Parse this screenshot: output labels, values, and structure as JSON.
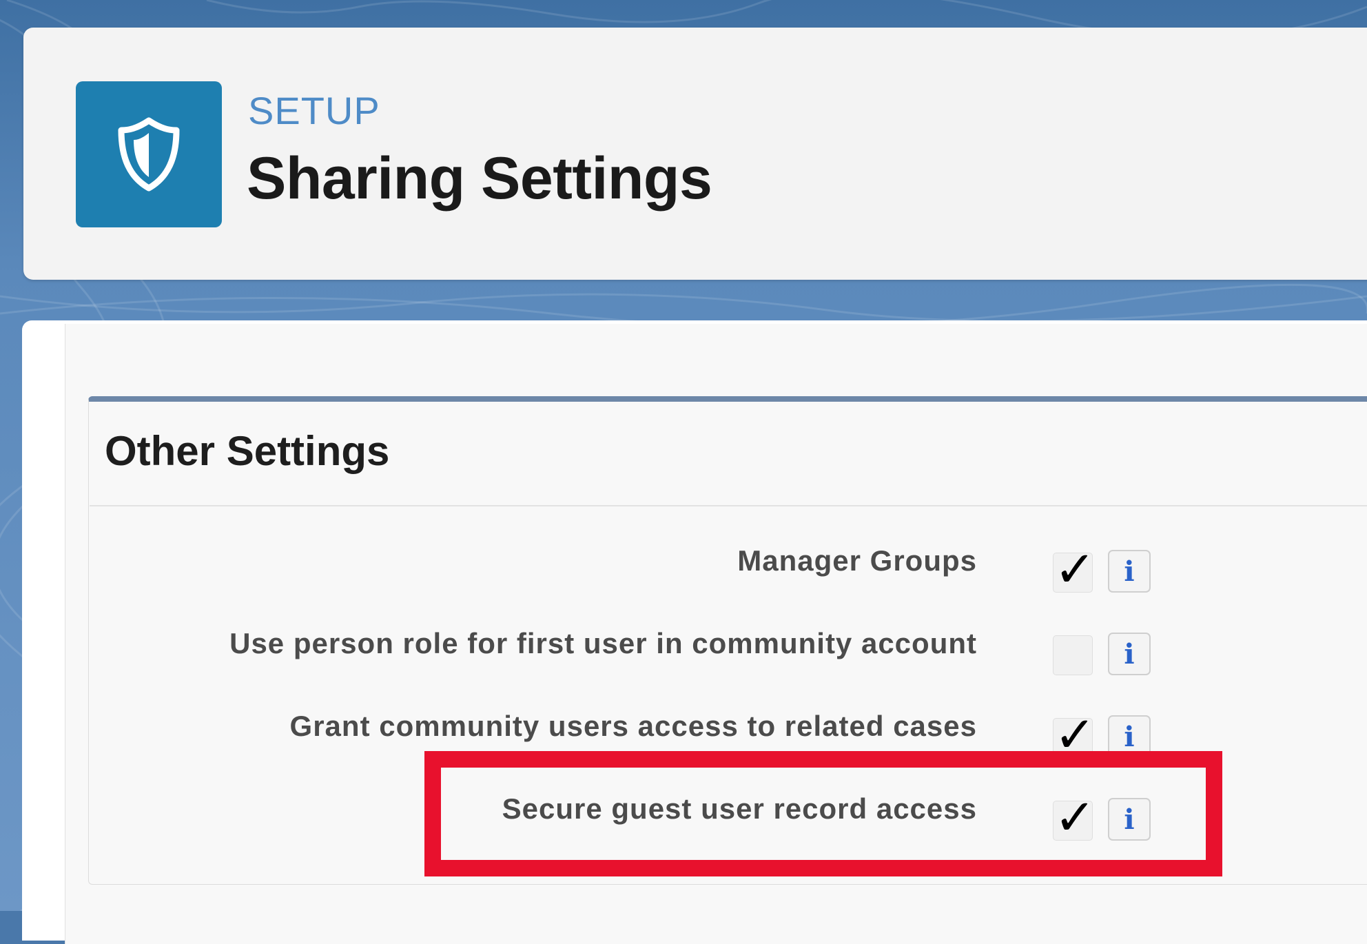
{
  "header": {
    "breadcrumb": "SETUP",
    "title": "Sharing Settings",
    "icon": "shield-icon",
    "icon_color": "#1e7fb0"
  },
  "section": {
    "title": "Other Settings",
    "rows": [
      {
        "label": "Manager Groups",
        "checked": true,
        "info": "i"
      },
      {
        "label": "Use person role for first user in community account",
        "checked": false,
        "info": "i"
      },
      {
        "label": "Grant community users access to related cases",
        "checked": true,
        "info": "i"
      },
      {
        "label": "Secure guest user record access",
        "checked": true,
        "info": "i"
      }
    ]
  },
  "check_glyph": "✓",
  "highlight_color": "#e8112d"
}
